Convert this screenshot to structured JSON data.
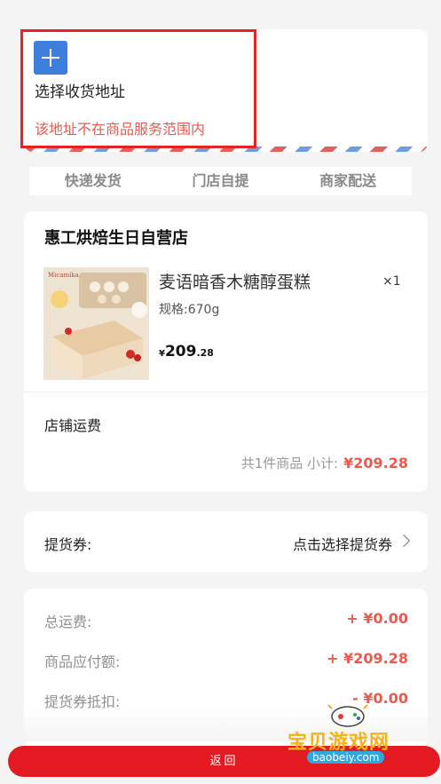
{
  "address": {
    "select_label": "选择收货地址",
    "warning": "该地址不在商品服务范围内"
  },
  "delivery_tabs": [
    "快递发货",
    "门店自提",
    "商家配送"
  ],
  "shop": {
    "name": "惠工烘焙生日自营店",
    "product": {
      "image_brand_text": "Micamika",
      "name": "麦语暗香木糖醇蛋糕",
      "spec": "规格:670g",
      "quantity": "×1",
      "price_symbol": "¥",
      "price_integer": "209",
      "price_decimal": ".28"
    },
    "shipping_label": "店铺运费",
    "subtotal_text": "共1件商品 小计:",
    "subtotal_amount": "¥209.28"
  },
  "coupon": {
    "label": "提货券:",
    "action": "点击选择提货券"
  },
  "summary": [
    {
      "label": "总运费:",
      "value": "+ ¥0.00"
    },
    {
      "label": "商品应付额:",
      "value": "+ ¥209.28"
    },
    {
      "label": "提货券抵扣:",
      "value": "- ¥0.00"
    }
  ],
  "footer": {
    "back_label": "返回"
  },
  "watermark": {
    "title": "宝贝游戏网",
    "domain": "baobeiy.com"
  },
  "colors": {
    "accent_red": "#e31a22",
    "price_red": "#e85a4f",
    "plus_blue": "#3d7ddc"
  }
}
